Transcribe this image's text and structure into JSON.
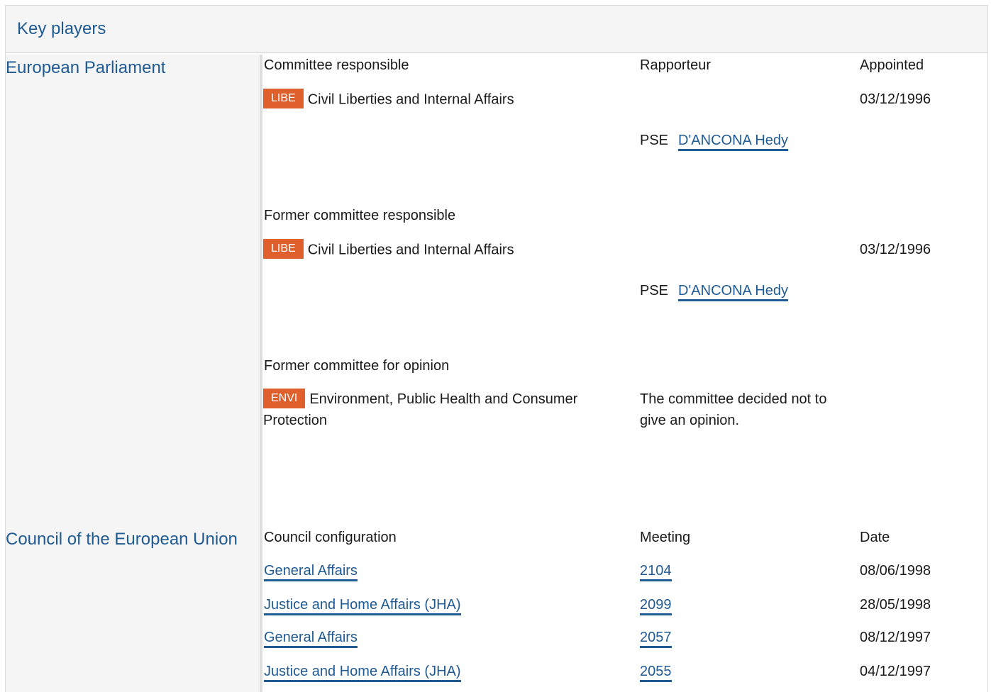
{
  "header": {
    "title": "Key players"
  },
  "parliament": {
    "title": "European Parliament",
    "col_committee": "Committee responsible",
    "col_rapporteur": "Rapporteur",
    "col_appointed": "Appointed",
    "responsible": {
      "badge": "LIBE",
      "name": "Civil Liberties and Internal Affairs",
      "appointed": "03/12/1996",
      "party": "PSE",
      "rapporteur": "D'ANCONA Hedy"
    },
    "former_responsible_label": "Former committee responsible",
    "former_responsible": {
      "badge": "LIBE",
      "name": "Civil Liberties and Internal Affairs",
      "appointed": "03/12/1996",
      "party": "PSE",
      "rapporteur": "D'ANCONA Hedy"
    },
    "former_opinion_label": "Former committee for opinion",
    "former_opinion": {
      "badge": "ENVI",
      "name": "Environment, Public Health and Consumer Protection",
      "note": "The committee decided not to give an opinion."
    }
  },
  "council": {
    "title": "Council of the European Union",
    "col_configuration": "Council configuration",
    "col_meeting": "Meeting",
    "col_date": "Date",
    "rows": [
      {
        "configuration": "General Affairs",
        "meeting": "2104",
        "date": "08/06/1998"
      },
      {
        "configuration": "Justice and Home Affairs (JHA)",
        "meeting": "2099",
        "date": "28/05/1998"
      },
      {
        "configuration": "General Affairs",
        "meeting": "2057",
        "date": "08/12/1997"
      },
      {
        "configuration": "Justice and Home Affairs (JHA)",
        "meeting": "2055",
        "date": "04/12/1997"
      }
    ]
  }
}
